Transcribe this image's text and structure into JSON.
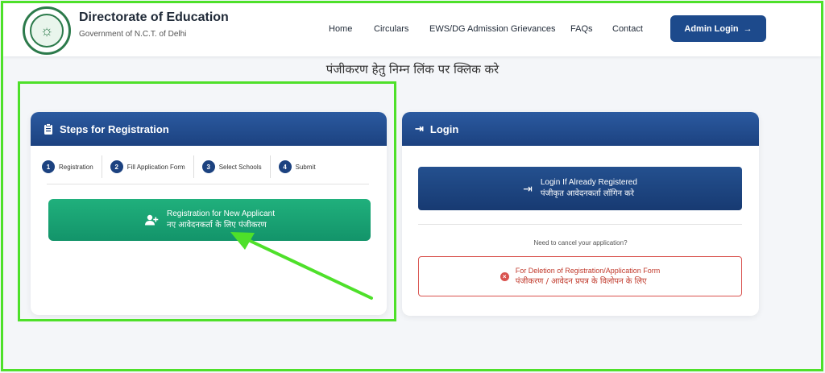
{
  "header": {
    "title": "Directorate of Education",
    "subtitle": "Government of N.C.T. of Delhi",
    "nav": [
      "Home",
      "Circulars",
      "EWS/DG Admission Grievances",
      "FAQs",
      "Contact"
    ],
    "admin_login": "Admin Login"
  },
  "page_heading": "पंजीकरण हेतु निम्न लिंक पर क्लिक करे",
  "registration_card": {
    "title": "Steps for Registration",
    "steps": [
      {
        "num": "1",
        "label": "Registration"
      },
      {
        "num": "2",
        "label": "Fill Application Form"
      },
      {
        "num": "3",
        "label": "Select Schools"
      },
      {
        "num": "4",
        "label": "Submit"
      }
    ],
    "new_applicant_en": "Registration for New Applicant",
    "new_applicant_hi": "नए आवेदनकर्ता के लिए पंजीकरण"
  },
  "login_card": {
    "title": "Login",
    "login_en": "Login If Already Registered",
    "login_hi": "पंजीकृत आवेदनकर्ता लॉगिन करे",
    "cancel_note": "Need to cancel your application?",
    "delete_en": "For Deletion of Registration/Application Form",
    "delete_hi": "पंजीकरण / आवेदन प्रपत्र के विलोपन के लिए"
  },
  "colors": {
    "primary": "#1d4a8c",
    "success": "#13946a",
    "danger": "#d9534f",
    "highlight": "#4ee02a"
  }
}
